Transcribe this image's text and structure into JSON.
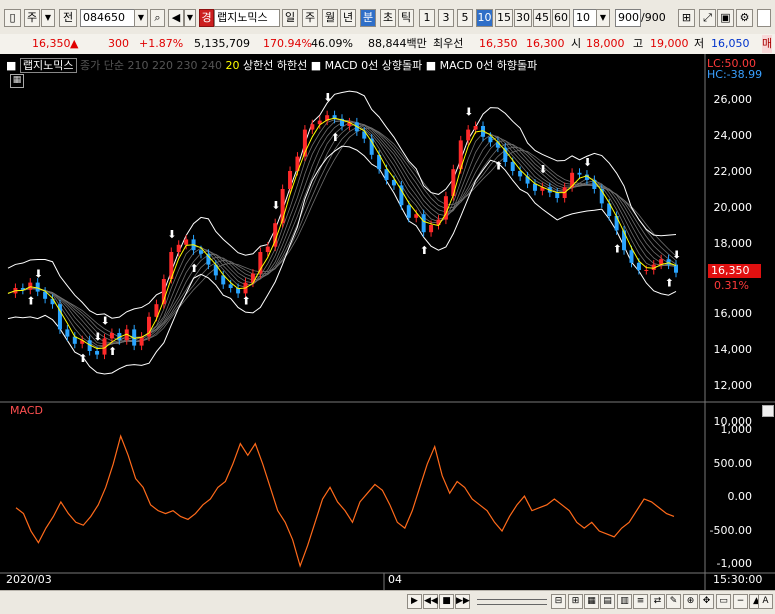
{
  "toolbar": {
    "period_label": "주",
    "ref_label": "전",
    "code_value": "084650",
    "stock_badge": "경",
    "stock_name": "랩지노믹스",
    "period_day": "일",
    "period_week": "주",
    "period_month": "월",
    "period_year": "년",
    "period_minute": "분",
    "period_second": "초",
    "period_tick": "틱",
    "intervals": [
      "1",
      "3",
      "5",
      "10",
      "15",
      "30",
      "45",
      "60"
    ],
    "selected_interval": "10",
    "count_value": "10",
    "bars_value": "900",
    "bars_total": "/900"
  },
  "quote": {
    "price": "16,350",
    "change": "300",
    "change_pct": "+1.87%",
    "volume": "5,135,709",
    "volume_ratio": "170.94%",
    "turnover": "46.09%",
    "amount": "88,844백만",
    "best_label": "최우선",
    "best_ask": "16,350",
    "best_bid": "16,300",
    "open_label": "시",
    "open": "18,000",
    "high_label": "고",
    "high": "19,000",
    "low_label": "저",
    "low": "16,050",
    "edge_label": "매"
  },
  "legend": {
    "stock": "랩지노믹스",
    "ma_label": "종가 단순",
    "ma_periods": [
      "210",
      "220",
      "230",
      "240"
    ],
    "ma_last": "20",
    "band_upper": "상한선",
    "band_lower": "하한선",
    "macd_up": "MACD 0선 상향돌파",
    "macd_down": "MACD 0선 하향돌파"
  },
  "chart": {
    "lc": "LC:50.00",
    "hc": "HC:-38.99",
    "last_price": "16,350",
    "last_pct": "0.31%",
    "price_ticks": [
      "26,000",
      "24,000",
      "22,000",
      "20,000",
      "18,000",
      "16,000",
      "14,000",
      "12,000",
      "10,000"
    ],
    "macd_label": "MACD",
    "macd_ticks": [
      "1,000",
      "500.00",
      "0.00",
      "-500.00",
      "-1,000"
    ],
    "x_labels": [
      "2020/03",
      "04"
    ],
    "time_label": "15:30:00"
  },
  "chart_data": {
    "type": "line",
    "price_ylim": [
      9500,
      26500
    ],
    "macd_ylim": [
      -1050,
      1250
    ],
    "price_close": [
      15200,
      15500,
      15400,
      15800,
      15300,
      14900,
      14600,
      13200,
      12800,
      12400,
      12600,
      12000,
      11800,
      12700,
      13000,
      12600,
      13200,
      12300,
      12800,
      13900,
      14600,
      16000,
      17500,
      17900,
      18200,
      17600,
      17400,
      16800,
      16200,
      15700,
      15500,
      15200,
      15800,
      16300,
      17500,
      17800,
      19100,
      21000,
      22000,
      22800,
      24300,
      24600,
      24800,
      25100,
      24900,
      24500,
      24700,
      24200,
      23800,
      22900,
      22100,
      21500,
      21200,
      20100,
      19400,
      19600,
      18600,
      19000,
      19300,
      20600,
      22100,
      23700,
      24300,
      24500,
      23900,
      23600,
      23300,
      22500,
      22000,
      21700,
      21300,
      20900,
      21100,
      20800,
      20500,
      21100,
      21900,
      21800,
      21500,
      21000,
      20200,
      19500,
      18700,
      17600,
      16900,
      16500,
      16500,
      16800,
      17100,
      16800,
      16350
    ],
    "macd": [
      -50,
      -150,
      -450,
      -650,
      -400,
      -200,
      50,
      -150,
      -300,
      -350,
      -200,
      0,
      300,
      700,
      1180,
      850,
      450,
      300,
      0,
      -100,
      -150,
      -100,
      -200,
      -250,
      -150,
      0,
      100,
      300,
      400,
      700,
      1050,
      850,
      1050,
      700,
      300,
      -100,
      -300,
      -600,
      -1050,
      -700,
      -300,
      100,
      300,
      50,
      -100,
      -300,
      50,
      200,
      350,
      250,
      0,
      -300,
      -400,
      -100,
      300,
      700,
      1000,
      500,
      200,
      400,
      300,
      100,
      0,
      -100,
      -300,
      -450,
      -200,
      0,
      150,
      -100,
      -50,
      0,
      100,
      0,
      -100,
      -300,
      -400,
      -300,
      -450,
      -500,
      -550,
      -400,
      -300,
      -100,
      100,
      50,
      -50,
      -150,
      -200
    ]
  }
}
